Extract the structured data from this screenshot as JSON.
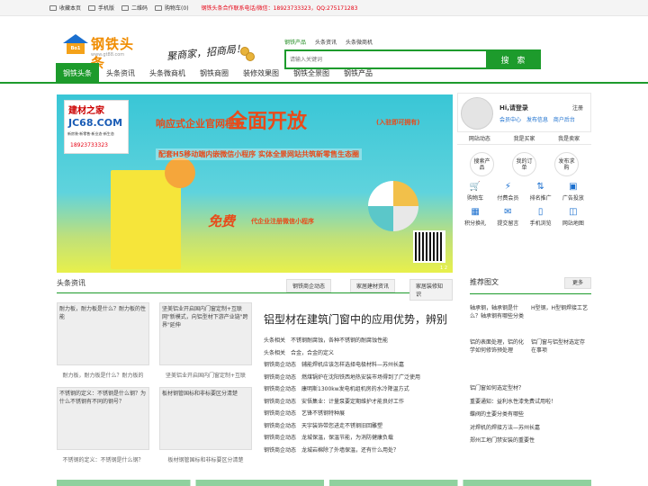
{
  "topbar": {
    "items": [
      "收藏本页",
      "手机版",
      "二维码",
      "购物车(0)"
    ],
    "promo": "钢铁头条合作联系电话/微信：18923733323，QQ:275171283"
  },
  "header": {
    "logo_text": "钢铁头条",
    "logo_house_text": "Bo1",
    "logo_url": "www.gt88.com",
    "slogan": "聚商家，招商局！"
  },
  "search": {
    "tabs": [
      "钢铁产品",
      "头条资讯",
      "头条微商机"
    ],
    "placeholder": "请输入关键词",
    "button": "搜 索"
  },
  "nav": {
    "items": [
      "钢铁头条",
      "头条资讯",
      "头条微商机",
      "钢铁商圈",
      "装修效果图",
      "钢铁全景图",
      "钢铁产品"
    ]
  },
  "banner": {
    "logo_a": "建材之家",
    "logo_b": "JC68.COM",
    "logo_c": "新房装·新零售·新业态·新生态",
    "logo_d": "18923733323",
    "t1": "响应式企业官网模板",
    "t2": "全面开放",
    "t3": "(入驻即可拥有)",
    "sub": "配套H5移动端内嵌微信小程序  实体全景网站共筑新零售生态圈",
    "free": "免费",
    "free2": "代企业注册微信小程序",
    "dots": "1 2"
  },
  "user_panel": {
    "greeting": "Hi,请登录",
    "register": "注册",
    "links": [
      "会员中心",
      "发布信息",
      "商户后台"
    ],
    "tabs": [
      "网站动态",
      "我是买家",
      "我是卖家"
    ],
    "quick": [
      "搜索产品",
      "我的订单",
      "发布求购"
    ],
    "icons": [
      {
        "label": "购物车",
        "glyph": "🛒"
      },
      {
        "label": "付费会员",
        "glyph": "⚡"
      },
      {
        "label": "排名推广",
        "glyph": "⇅"
      },
      {
        "label": "广告投放",
        "glyph": "▣"
      },
      {
        "label": "积分换礼",
        "glyph": "▦"
      },
      {
        "label": "提交留言",
        "glyph": "✉"
      },
      {
        "label": "手机浏览",
        "glyph": "▯"
      },
      {
        "label": "网站地图",
        "glyph": "◫"
      }
    ]
  },
  "section": {
    "title": "头条资讯",
    "tabs": [
      "钢铁商企动态",
      "家居建材资讯",
      "家居装修知识"
    ]
  },
  "news_images": [
    {
      "text": "耐力板，耐力板是什么？耐力板的性能",
      "cap": "耐力板，耐力板是什么？耐力板的"
    },
    {
      "text": "坚美铝业开启国内门窗定制+互联网\"新模式，向铝型材下游产业链\"跨界\"延伸",
      "cap": "坚美铝业开启国内门窗定制+互联"
    },
    {
      "text": "不锈钢的定义：不锈钢是什么钢？为什么不锈钢有不同的钢号？",
      "cap": "不锈钢的定义：不锈钢是什么钢？"
    },
    {
      "text": "板材钢管国标和非标要区分清楚",
      "cap": "板材钢管国标和非标要区分清楚"
    }
  ],
  "headline": "铝型材在建筑门窗中的应用优势，辨别",
  "news_list": [
    {
      "cat": "头条相关",
      "title": "不锈钢耐腐蚀，各种不锈钢的耐腐蚀性能"
    },
    {
      "cat": "头条相关",
      "title": "合金，合金的定义"
    },
    {
      "cat": "钢铁商企动态",
      "title": "辅能焊机应该怎样选择电极材料—苏州长嘉"
    },
    {
      "cat": "钢铁商企动态",
      "title": "燃煤锅炉在沈阳铁西地热安装市场得到了广泛使用"
    },
    {
      "cat": "钢铁商企动态",
      "title": "康明斯1300kw发电机组机房的水冷降温方式"
    },
    {
      "cat": "钢铁商企动态",
      "title": "安悟集业：计量泵要定期维护才能良好工作"
    },
    {
      "cat": "钢铁商企动态",
      "title": "艺锋不锈钢特种展"
    },
    {
      "cat": "钢铁商企动态",
      "title": "天宇装饰带您进走不锈钢旧回雕塑"
    },
    {
      "cat": "钢铁商企动态",
      "title": "龙城保温，保温节能，为消防健康负载"
    },
    {
      "cat": "钢铁商企动态",
      "title": "龙城岩棉除了外墙保温，还有什么用处？"
    }
  ],
  "recommend": {
    "title": "推荐图文",
    "more": "更多",
    "imgs": [
      "轴承钢，轴承钢是什么？轴承钢有哪些分类",
      "H型钢，H型钢焊接工艺",
      "铝的表面处理，铝的化学如何修饰预处理",
      "铝门窗与铝型材选定存在事项"
    ],
    "list": [
      "轴承钢，轴承钢是什么？轴承钢有哪些分类",
      "H型钢，H型钢焊接工艺",
      "铝的表面处理，铝的化学如何修饰预处理",
      "铝门窗工程中型材的选定存在事项",
      "铝门窗如何选定型材？",
      "重要通知：益利水性漆免费试用啦！",
      "蝶阀的主要分类有哪些",
      "对焊机的焊接方法—苏州长嘉",
      "郑州工地门禁安装的重要性"
    ]
  },
  "colors": {
    "accent": "#1d9b2c",
    "promo": "#e60012",
    "link": "#1a6fcf"
  }
}
